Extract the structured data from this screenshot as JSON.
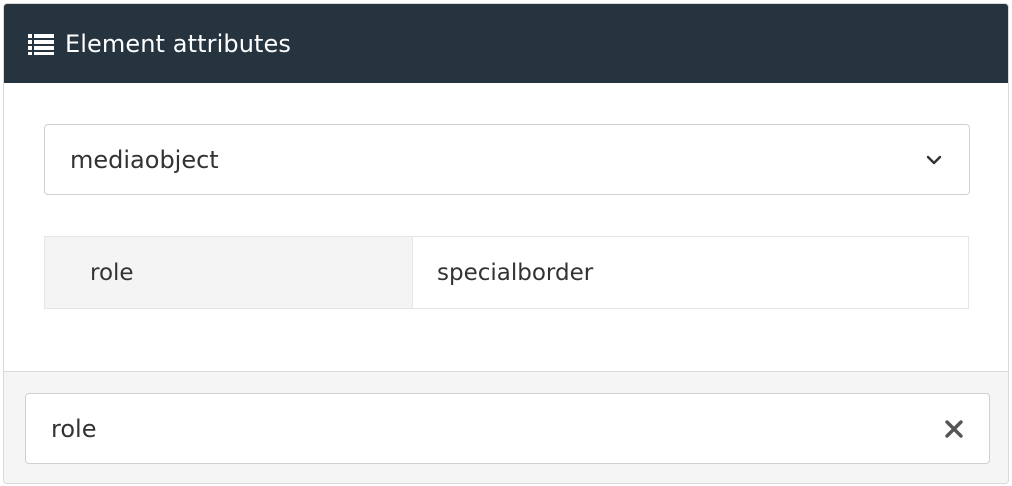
{
  "header": {
    "icon": "list-icon",
    "title": "Element attributes"
  },
  "element_select": {
    "selected": "mediaobject",
    "icon": "chevron-down-icon"
  },
  "attributes": [
    {
      "name": "role",
      "value": "specialborder"
    }
  ],
  "filter": {
    "value": "role",
    "clear_icon": "close-icon"
  },
  "colors": {
    "header_bg": "#26343f",
    "header_text": "#ffffff",
    "footer_bg": "#f5f5f5",
    "key_cell_bg": "#f4f4f4"
  }
}
